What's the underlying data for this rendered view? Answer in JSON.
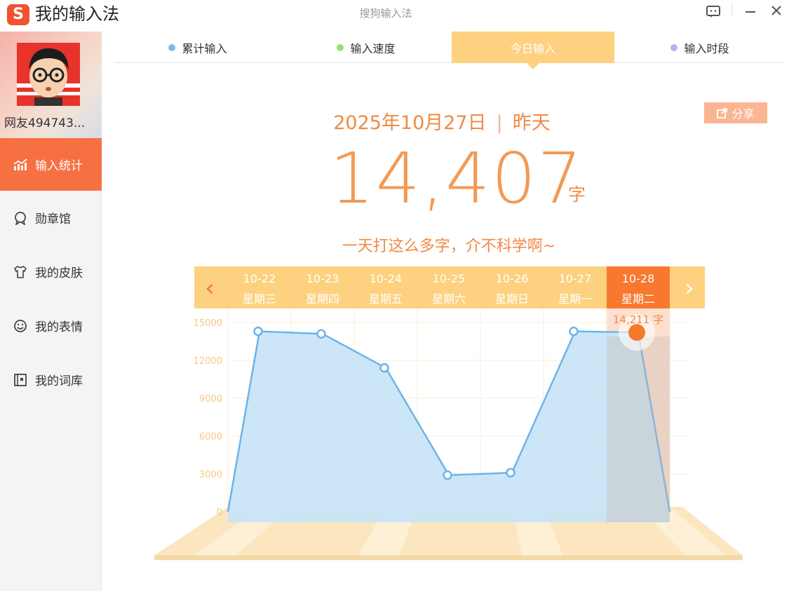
{
  "app": {
    "logo_letter": "S",
    "title": "我的输入法",
    "window_title": "搜狗输入法"
  },
  "user": {
    "name": "网友494743..."
  },
  "sidebar": {
    "items": [
      {
        "label": "输入统计",
        "icon": "chart-icon",
        "active": true
      },
      {
        "label": "勋章馆",
        "icon": "medal-icon",
        "active": false
      },
      {
        "label": "我的皮肤",
        "icon": "shirt-icon",
        "active": false
      },
      {
        "label": "我的表情",
        "icon": "smiley-icon",
        "active": false
      },
      {
        "label": "我的词库",
        "icon": "dictionary-icon",
        "active": false
      }
    ]
  },
  "tabs": [
    {
      "label": "累计输入",
      "dot_color": "#7fb7ef",
      "active": false
    },
    {
      "label": "输入速度",
      "dot_color": "#9edc6e",
      "active": false
    },
    {
      "label": "今日输入",
      "dot_color": "",
      "active": true
    },
    {
      "label": "输入时段",
      "dot_color": "#a9b8ee",
      "active": false
    }
  ],
  "summary": {
    "date": "2025年10月27日",
    "separator": "|",
    "relative_day": "昨天",
    "count": "14,407",
    "unit": "字",
    "slogan": "一天打这么多字，介不科学啊~",
    "share_label": "分享"
  },
  "colors": {
    "accent": "#f77042",
    "tab_active": "#fdd17f",
    "date_strip": "#fdd17f",
    "date_selected": "#f7782e",
    "area_fill": "#c6e3f7",
    "line": "#6db3ea",
    "axis_label": "#f8c87e"
  },
  "chart_data": {
    "type": "area",
    "categories": [
      "10-22",
      "10-23",
      "10-24",
      "10-25",
      "10-26",
      "10-27",
      "10-28"
    ],
    "weekdays": [
      "星期三",
      "星期四",
      "星期五",
      "星期六",
      "星期日",
      "星期一",
      "星期二"
    ],
    "values": [
      14300,
      14100,
      11400,
      2900,
      3100,
      14300,
      14211
    ],
    "selected_index": 6,
    "selected_label": "14,211 字",
    "yticks": [
      0,
      3000,
      6000,
      9000,
      12000,
      15000
    ],
    "ylim": [
      0,
      16000
    ],
    "grid": true,
    "nav_prev": "‹",
    "nav_next": "›"
  }
}
